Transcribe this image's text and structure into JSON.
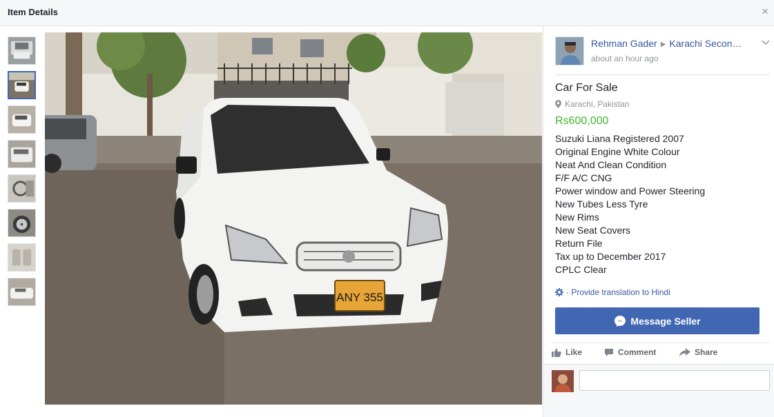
{
  "header": {
    "title": "Item Details",
    "close_icon": "close-icon"
  },
  "thumbnails": [
    {
      "name": "thumb-1",
      "active": false
    },
    {
      "name": "thumb-2",
      "active": true
    },
    {
      "name": "thumb-3",
      "active": false
    },
    {
      "name": "thumb-4",
      "active": false
    },
    {
      "name": "thumb-5",
      "active": false
    },
    {
      "name": "thumb-6",
      "active": false
    },
    {
      "name": "thumb-7",
      "active": false
    },
    {
      "name": "thumb-8",
      "active": false
    }
  ],
  "photo": {
    "plate_text": "ANY 355"
  },
  "post": {
    "author": "Rehman Gader",
    "group": "Karachi Secon…",
    "timestamp": "about an hour ago"
  },
  "listing": {
    "title": "Car For Sale",
    "location": "Karachi, Pakistan",
    "price": "Rs600,000",
    "description": [
      "Suzuki Liana Registered 2007",
      "Original Engine White Colour",
      "Neat And Clean Condition",
      "F/F A/C CNG",
      "Power window and Power Steering",
      "New Tubes Less Tyre",
      "New Rims",
      "New Seat Covers",
      "Return File",
      "Tax up to December 2017",
      "CPLC Clear"
    ],
    "translate_link": "· Provide translation to Hindi",
    "message_button": "Message Seller"
  },
  "actions": {
    "like": "Like",
    "comment": "Comment",
    "share": "Share"
  },
  "colors": {
    "accent": "#4267b2",
    "link": "#365899",
    "price": "#42b72a",
    "muted": "#90949c"
  }
}
